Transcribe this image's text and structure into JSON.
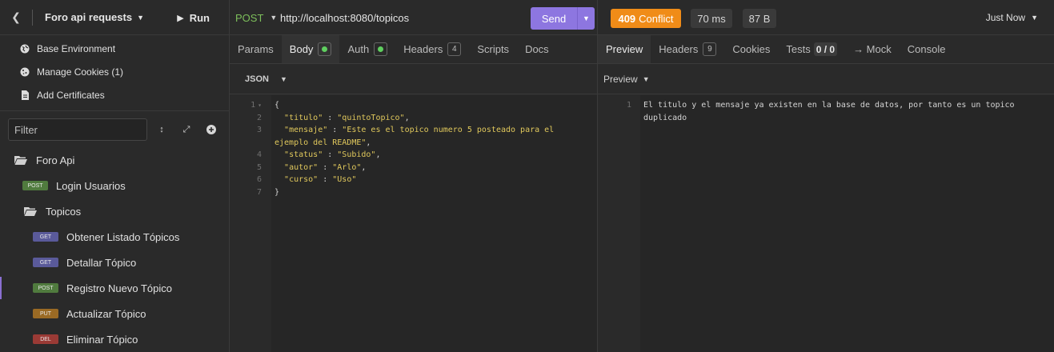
{
  "sidebar": {
    "title": "Foro api requests",
    "run_label": "Run",
    "links": [
      {
        "icon": "globe-icon",
        "label": "Base Environment"
      },
      {
        "icon": "cookie-icon",
        "label": "Manage Cookies (1)"
      },
      {
        "icon": "certificate-icon",
        "label": "Add Certificates"
      }
    ],
    "filter_placeholder": "Filter",
    "tree": {
      "root": "Foro Api",
      "login": {
        "method": "POST",
        "label": "Login Usuarios"
      },
      "folder": "Topicos",
      "requests": [
        {
          "method": "GET",
          "label": "Obtener Listado Tópicos"
        },
        {
          "method": "GET",
          "label": "Detallar Tópico"
        },
        {
          "method": "POST",
          "label": "Registro Nuevo Tópico"
        },
        {
          "method": "PUT",
          "label": "Actualizar Tópico"
        },
        {
          "method": "DEL",
          "label": "Eliminar Tópico"
        }
      ]
    }
  },
  "request": {
    "method": "POST",
    "url": "http://localhost:8080/topicos",
    "send_label": "Send",
    "tabs": {
      "params": "Params",
      "body": "Body",
      "auth": "Auth",
      "headers": "Headers",
      "headers_count": "4",
      "scripts": "Scripts",
      "docs": "Docs"
    },
    "format": "JSON",
    "line_numbers": [
      "1",
      "2",
      "3",
      "",
      "4",
      "5",
      "6",
      "7"
    ],
    "body": {
      "open": "{",
      "l2_key": "\"titulo\"",
      "l2_val": "\"quintoTopico\"",
      "l3_key": "\"mensaje\"",
      "l3_val_a": "\"Este es el topico numero 5 posteado para el",
      "l3_val_b": "ejemplo del README\"",
      "l4_key": "\"status\"",
      "l4_val": "\"Subido\"",
      "l5_key": "\"autor\"",
      "l5_val": "\"Arlo\"",
      "l6_key": "\"curso\"",
      "l6_val": "\"Uso\"",
      "close": "}"
    }
  },
  "response": {
    "status_code": "409",
    "status_text": "Conflict",
    "time": "70 ms",
    "size": "87 B",
    "timestamp": "Just Now",
    "tabs": {
      "preview": "Preview",
      "headers": "Headers",
      "headers_count": "9",
      "cookies": "Cookies",
      "tests": "Tests",
      "tests_count": "0 / 0",
      "mock": "→ Mock",
      "console": "Console"
    },
    "preview_mode": "Preview",
    "line_number": "1",
    "body": "El titulo y el mensaje ya existen en la base de datos, por tanto es un topico duplicado"
  },
  "colors": {
    "accent": "#8d76e0",
    "status_conflict": "#f08c18",
    "method_post": "#7dbf5b"
  }
}
